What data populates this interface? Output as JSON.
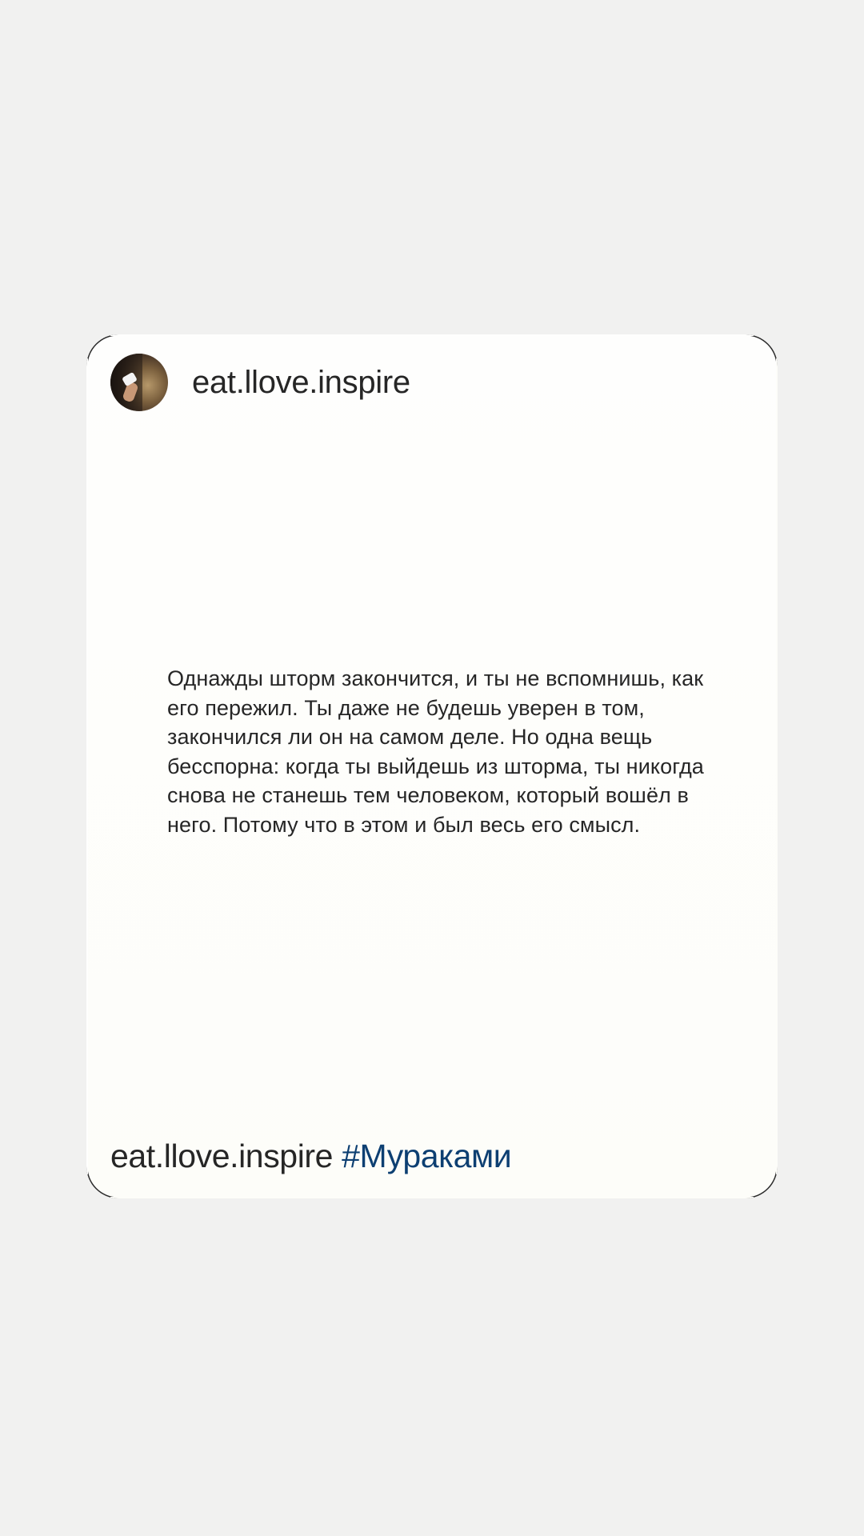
{
  "post": {
    "username": "eat.llove.inspire",
    "quote": "Однажды шторм закончится, и ты не вспомнишь, как его пережил. Ты даже не будешь уверен в том, закончился ли он на самом деле. Но одна вещь бесспорна: когда ты выйдешь из шторма, ты никогда снова не станешь тем человеком, который вошёл в него. Потому что в этом и был весь его смысл.",
    "footer_username": "eat.llove.inspire",
    "hashtag": "#Мураками"
  },
  "colors": {
    "background": "#f1f1f0",
    "card": "#fefefd",
    "text": "#262626",
    "hashtag": "#0d3f72"
  }
}
